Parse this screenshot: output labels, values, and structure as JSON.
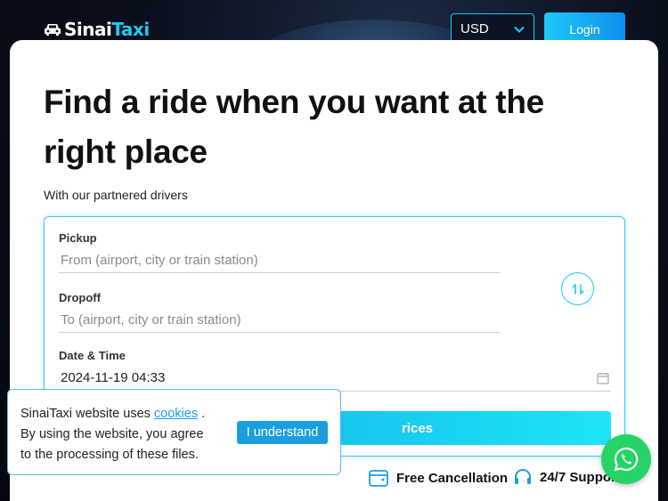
{
  "header": {
    "logo_part1": "Sinai",
    "logo_part2": "Taxi",
    "currency": "USD",
    "login_label": "Login"
  },
  "hero": {
    "title": "Find a ride when you want at the right place",
    "subtitle": "With our partnered drivers"
  },
  "form": {
    "pickup_label": "Pickup",
    "pickup_placeholder": "From (airport, city or train station)",
    "dropoff_label": "Dropoff",
    "dropoff_placeholder": "To (airport, city or train station)",
    "datetime_label": "Date & Time",
    "datetime_value": "2024-11-19 04:33",
    "search_label": "rices"
  },
  "features": {
    "free_cancellation": "Free Cancellation",
    "support": "24/7 Support"
  },
  "cookie": {
    "text_before": "SinaiTaxi website uses ",
    "link": "cookies",
    "text_after": " .",
    "line2": "By using the website, you agree",
    "line3": "to the processing of these files.",
    "button": "I understand"
  },
  "icons": {
    "car": "car-icon",
    "chevron": "chevron-down-icon",
    "swap": "swap-icon",
    "calendar": "calendar-icon",
    "wallet": "wallet-icon",
    "headset": "headset-icon",
    "whatsapp": "whatsapp-icon"
  },
  "colors": {
    "accent": "#1ec8f5",
    "whatsapp": "#25d366"
  }
}
